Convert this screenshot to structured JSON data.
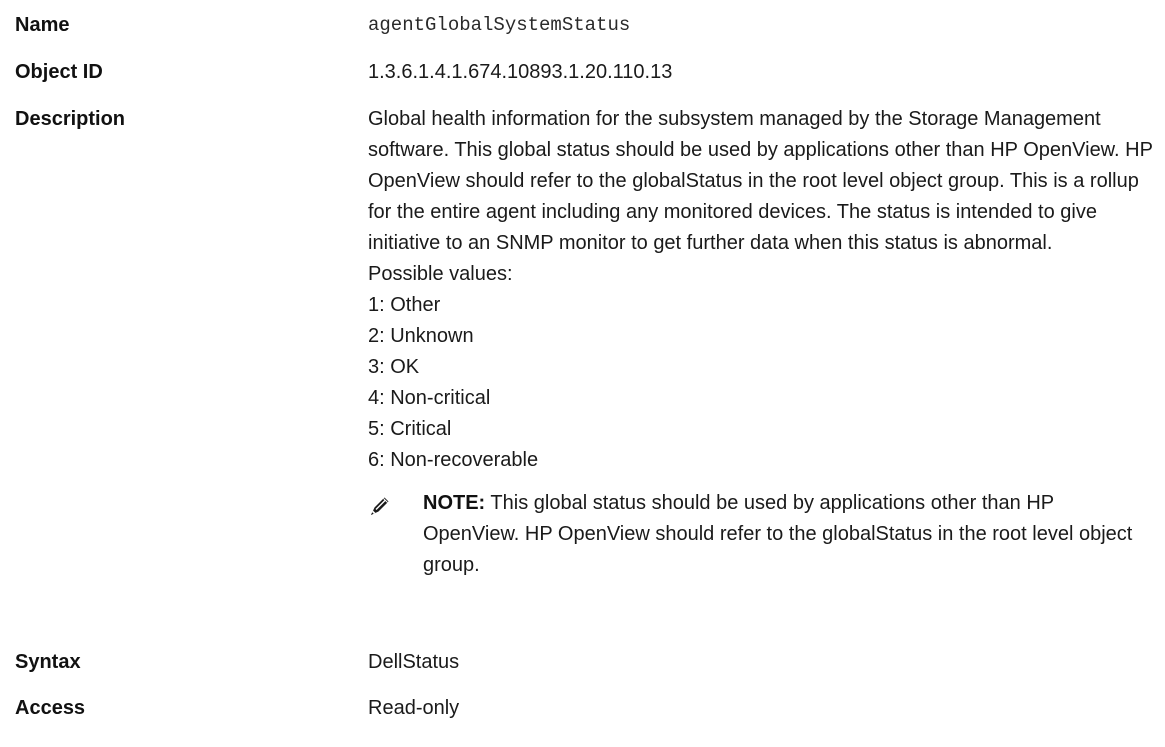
{
  "fields": {
    "name": {
      "label": "Name",
      "value": "agentGlobalSystemStatus"
    },
    "object_id": {
      "label": "Object ID",
      "value": "1.3.6.1.4.1.674.10893.1.20.110.13"
    },
    "description": {
      "label": "Description",
      "text": "Global health information for the subsystem managed by the Storage Management software. This global status should be used by applications other than HP OpenView. HP OpenView should refer to the globalStatus in the root level object group. This is a rollup for the entire agent including any monitored devices. The status is intended to give initiative to an SNMP monitor to get further data when this status is abnormal.",
      "values_intro": "Possible values:",
      "values": [
        "1: Other",
        "2: Unknown",
        "3: OK",
        "4: Non-critical",
        "5: Critical",
        "6: Non-recoverable"
      ],
      "note": {
        "icon": "pencil-note-icon",
        "label": "NOTE:",
        "text": "This global status should be used by applications other than HP OpenView. HP OpenView should refer to the globalStatus in the root level object group."
      }
    },
    "syntax": {
      "label": "Syntax",
      "value": "DellStatus"
    },
    "access": {
      "label": "Access",
      "value": "Read-only"
    }
  }
}
